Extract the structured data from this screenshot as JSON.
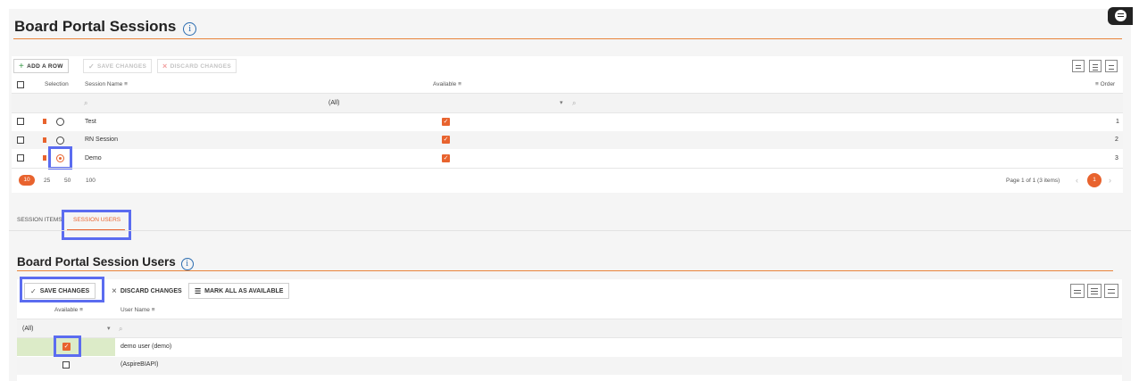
{
  "header": {
    "title": "Board Portal Sessions",
    "info_glyph": "i"
  },
  "sessions_toolbar": {
    "add_row": "ADD A ROW",
    "save_changes": "SAVE CHANGES",
    "discard_changes": "DISCARD CHANGES"
  },
  "sessions_grid": {
    "col_selection": "Selection",
    "col_session_name": "Session Name",
    "col_available": "Available",
    "col_order": "Order",
    "filter_available": "(All)",
    "rows": [
      {
        "name": "Test",
        "available": true,
        "order": "1",
        "selected": false
      },
      {
        "name": "RN Session",
        "available": true,
        "order": "2",
        "selected": false
      },
      {
        "name": "Demo",
        "available": true,
        "order": "3",
        "selected": true
      }
    ],
    "page_sizes": [
      "10",
      "25",
      "50",
      "100"
    ],
    "page_info": "Page 1 of 1 (3 items)",
    "current_page": "1"
  },
  "tabs": {
    "session_items": "SESSION ITEMS",
    "session_users": "SESSION USERS"
  },
  "users_section": {
    "title": "Board Portal Session Users",
    "save_changes": "SAVE CHANGES",
    "discard_changes": "DISCARD CHANGES",
    "mark_all": "MARK ALL AS AVAILABLE",
    "col_available": "Available",
    "col_user_name": "User Name",
    "filter_available": "(All)",
    "rows": [
      {
        "user": "demo user (demo)",
        "available": true
      },
      {
        "user": "(AspireBIAPI)",
        "available": false
      }
    ]
  },
  "colors": {
    "accent": "#e8632e",
    "highlight": "#5b6cf0",
    "title_rule": "#e8833a"
  }
}
